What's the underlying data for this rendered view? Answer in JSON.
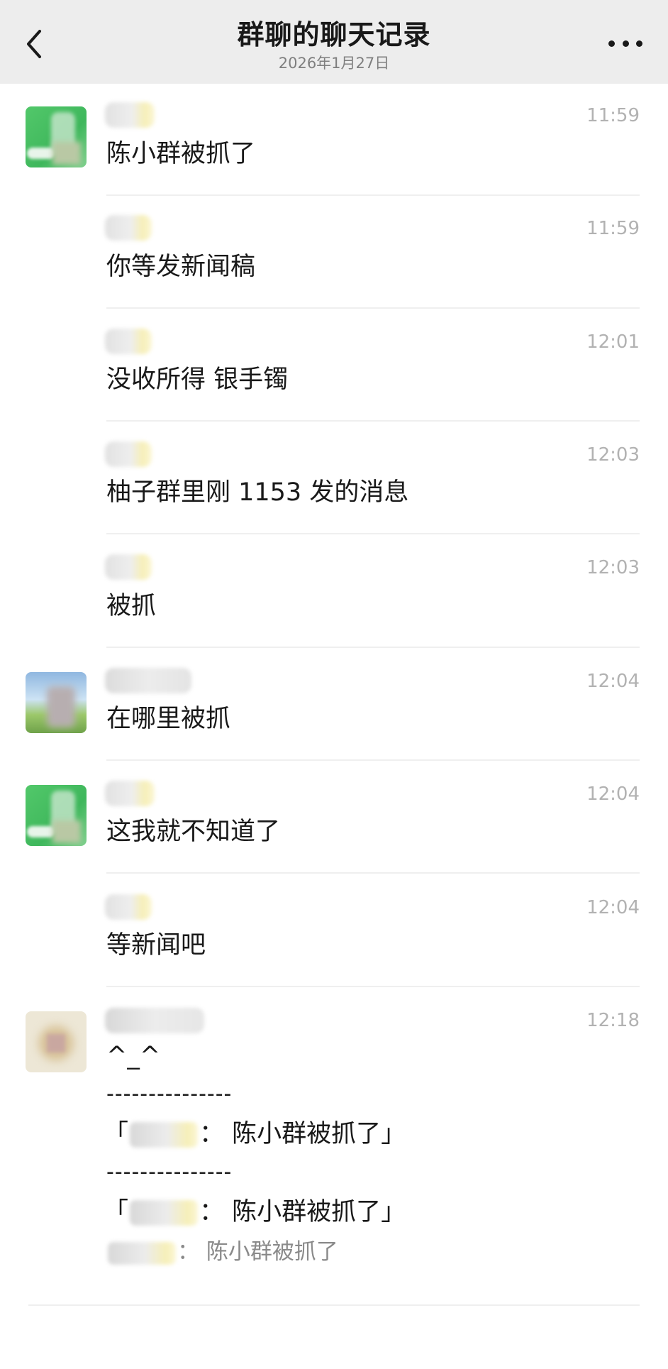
{
  "header": {
    "title": "群聊的聊天记录",
    "subtitle": "2026年1月27日"
  },
  "messages": [
    {
      "time": "11:59",
      "text": "陈小群被抓了"
    },
    {
      "time": "11:59",
      "text": "你等发新闻稿"
    },
    {
      "time": "12:01",
      "text": "没收所得 银手镯"
    },
    {
      "time": "12:03",
      "text": "柚子群里刚 1153 发的消息"
    },
    {
      "time": "12:03",
      "text": "被抓"
    },
    {
      "time": "12:04",
      "text": "在哪里被抓"
    },
    {
      "time": "12:04",
      "text": "这我就不知道了"
    },
    {
      "time": "12:04",
      "text": "等新闻吧"
    },
    {
      "time": "12:18",
      "lines": {
        "line1": "^_^",
        "dash1": "---------------",
        "quote1_open": "「",
        "quote1_text": "：  陈小群被抓了」",
        "dash2": "---------------",
        "quote2_open": "「",
        "quote2_text": "：  陈小群被抓了」",
        "quote3_text": "：  陈小群被抓了"
      }
    }
  ],
  "colors": {
    "header_bg": "#ededed",
    "time_text": "#b2b2b2",
    "divider": "#efefef"
  },
  "icons": {
    "back": "chevron-left-icon",
    "more": "more-dots-icon"
  }
}
